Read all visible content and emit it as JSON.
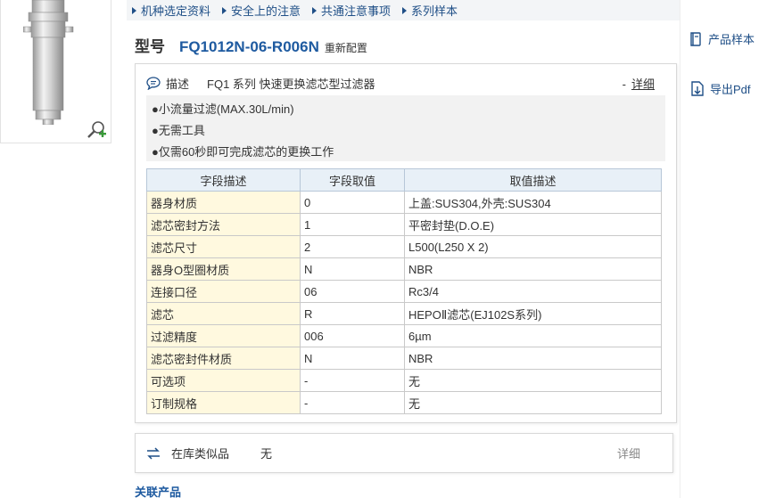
{
  "nav": {
    "items": [
      "机种选定资料",
      "安全上的注意",
      "共通注意事项",
      "系列样本"
    ]
  },
  "title": {
    "label": "型号",
    "code": "FQ1012N-06-R006N",
    "reset": "重新配置"
  },
  "side": {
    "catalog": "产品样本",
    "export_pdf": "导出Pdf"
  },
  "description": {
    "label": "描述",
    "text": "FQ1 系列 快速更换滤芯型过滤器",
    "more_prefix": "-",
    "more": "详细",
    "bullets": [
      "●小流量过滤(MAX.30L/min)",
      "●无需工具",
      "●仅需60秒即可完成滤芯的更换工作"
    ]
  },
  "spec_table": {
    "headers": [
      "字段描述",
      "字段取值",
      "取值描述"
    ],
    "rows": [
      [
        "器身材质",
        "0",
        "上盖:SUS304,外壳:SUS304"
      ],
      [
        "滤芯密封方法",
        "1",
        "平密封垫(D.O.E)"
      ],
      [
        "滤芯尺寸",
        "2",
        "L500(L250 X 2)"
      ],
      [
        "器身O型圈材质",
        "N",
        "NBR"
      ],
      [
        "连接口径",
        "06",
        "Rc3/4"
      ],
      [
        "滤芯",
        "R",
        "HEPOⅡ滤芯(EJ102S系列)"
      ],
      [
        "过滤精度",
        "006",
        "6µm"
      ],
      [
        "滤芯密封件材质",
        "N",
        "NBR"
      ],
      [
        "可选项",
        "-",
        "无"
      ],
      [
        "订制规格",
        "-",
        "无"
      ]
    ]
  },
  "stock": {
    "label": "在库类似品",
    "value": "无",
    "more": "详细"
  },
  "related": {
    "title": "关联产品"
  },
  "colors": {
    "link": "#1f4f87",
    "code": "#1e5aa0",
    "header_bg": "#e8f0f7",
    "label_bg": "#fff9df"
  }
}
